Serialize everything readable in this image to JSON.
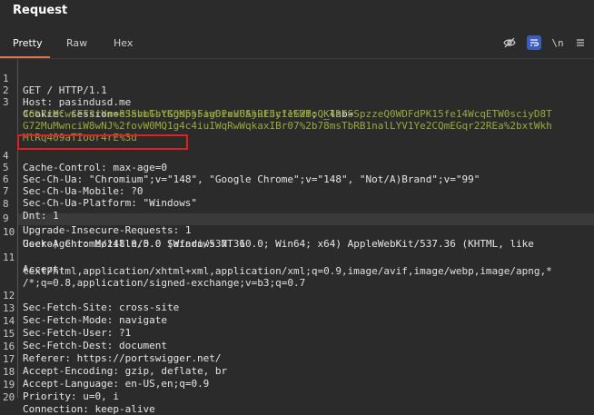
{
  "window": {
    "title": "Request"
  },
  "tabs": [
    {
      "label": "Pretty",
      "active": true
    },
    {
      "label": "Raw",
      "active": false
    },
    {
      "label": "Hex",
      "active": false
    }
  ],
  "toolbar": {
    "hide_icon": "eye-slash-icon",
    "wrap_icon": "wrap-lines-icon",
    "newline_label": "\\n",
    "menu_icon": "hamburger-menu-icon"
  },
  "colors": {
    "accent": "#e8743b",
    "highlight_box": "#e02020",
    "cookie_value": "#9aa83a",
    "active_tool": "#3d5dbd"
  },
  "lines": [
    {
      "num": "1",
      "text": "GET / HTTP/1.1"
    },
    {
      "num": "2",
      "text": "Host: pasindusd.me"
    },
    {
      "num": "3",
      "name": "Cookie: ",
      "pre": "session=",
      "val": "eSSvLTsYGQMpj5aw0PxU6SjuEhy11EWB",
      "post": "; _lab="
    },
    {
      "num": "",
      "val": "46%7cMCwCFF2rYmo8JahmGbtKgs5hFigDioxUAhRtJcfe%2foQK4DfSSpzzeQ0WDFdPK15fe14WcqETW0sciyD8T"
    },
    {
      "num": "",
      "val": "G72MuMwnciW8wNJ%2fovW0MQ1g4c4iuIWqRwWqkaxIBr07%2b78msTbRB1nalLYV1Ye2CQmEGqr22REa%2bxtWkh"
    },
    {
      "num": "",
      "val": "MlRq409aTIoor4rE%3d"
    },
    {
      "num": "4",
      "name": "Cache-Control: ",
      "rest": "max-age=0"
    },
    {
      "num": "5",
      "name": "Sec-Ch-Ua: ",
      "rest": "\"Chromium\";v=\"148\", \"Google Chrome\";v=\"148\", \"Not/A)Brand\";v=\"99\""
    },
    {
      "num": "6",
      "name": "Sec-Ch-Ua-Mobile: ",
      "rest": "?0"
    },
    {
      "num": "7",
      "name": "Sec-Ch-Ua-Platform: ",
      "rest": "\"Windows\""
    },
    {
      "num": "8",
      "name": "Dnt: ",
      "rest": "1"
    },
    {
      "num": "9",
      "name": "Upgrade-Insecure-Requests: ",
      "rest": "1"
    },
    {
      "num": "10",
      "name": "User-Agent: ",
      "rest": "Mozilla/5.0 (Windows NT 10.0; Win64; x64) AppleWebKit/537.36 (KHTML, like"
    },
    {
      "num": "",
      "text": "Gecko) Chrome/148.0.0.0 Safari/537.36"
    },
    {
      "num": "11",
      "text": "Accept:"
    },
    {
      "num": "",
      "text": "text/html,application/xhtml+xml,application/xml;q=0.9,image/avif,image/webp,image/apng,*"
    },
    {
      "num": "",
      "text": "/*;q=0.8,application/signed-exchange;v=b3;q=0.7"
    },
    {
      "num": "12",
      "name": "Sec-Fetch-Site: ",
      "rest": "cross-site"
    },
    {
      "num": "13",
      "name": "Sec-Fetch-Mode: ",
      "rest": "navigate"
    },
    {
      "num": "14",
      "name": "Sec-Fetch-User: ",
      "rest": "?1"
    },
    {
      "num": "15",
      "name": "Sec-Fetch-Dest: ",
      "rest": "document"
    },
    {
      "num": "16",
      "name": "Referer: ",
      "rest": "https://portswigger.net/"
    },
    {
      "num": "17",
      "name": "Accept-Encoding: ",
      "rest": "gzip, deflate, br"
    },
    {
      "num": "18",
      "name": "Accept-Language: ",
      "rest": "en-US,en;q=0.9"
    },
    {
      "num": "19",
      "name": "Priority: ",
      "rest": "u=0, i"
    },
    {
      "num": "20",
      "name": "Connection: ",
      "rest": "keep-alive"
    }
  ]
}
